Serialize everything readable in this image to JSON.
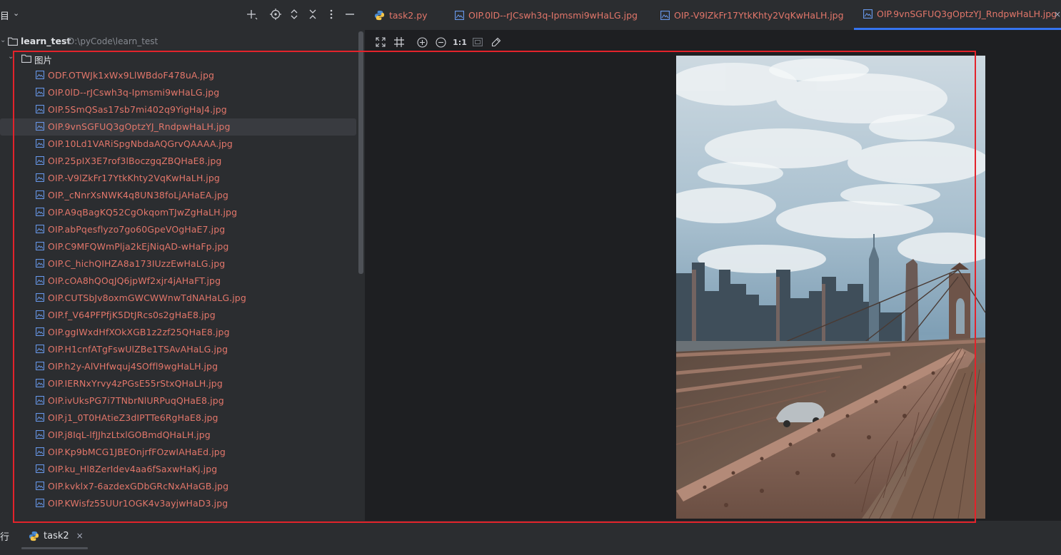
{
  "panel": {
    "title": "目",
    "root_name": "learn_test",
    "root_path": "D:\\pyCode\\learn_test",
    "folder_name": "图片",
    "files": [
      "ODF.OTWJk1xWx9LlWBdoF478uA.jpg",
      "OIP.0lD--rJCswh3q-Ipmsmi9wHaLG.jpg",
      "OIP.5SmQSas17sb7mi402q9YigHaJ4.jpg",
      "OIP.9vnSGFUQ3gOptzYJ_RndpwHaLH.jpg",
      "OIP.10Ld1VARiSpgNbdaAQGrvQAAAA.jpg",
      "OIP.25pIX3E7rof3lBoczgqZBQHaE8.jpg",
      "OIP.-V9lZkFr17YtkKhty2VqKwHaLH.jpg",
      "OIP._cNnrXsNWK4q8UN38foLjAHaEA.jpg",
      "OIP.A9qBagKQ52CgOkqomTJwZgHaLH.jpg",
      "OIP.abPqesflyzo7go60GpeVOgHaE7.jpg",
      "OIP.C9MFQWmPlja2kEjNiqAD-wHaFp.jpg",
      "OIP.C_hichQIHZA8a173IUzzEwHaLG.jpg",
      "OIP.cOA8hQOqJQ6jpWf2xjr4jAHaFT.jpg",
      "OIP.CUTSbJv8oxmGWCWWnwTdNAHaLG.jpg",
      "OIP.f_V64PFPfjK5DtJRcs0s2gHaE8.jpg",
      "OIP.ggIWxdHfXOkXGB1z2zf25QHaE8.jpg",
      "OIP.H1cnfATgFswUlZBe1TSAvAHaLG.jpg",
      "OIP.h2y-AlVHfwquj4SOffl9wgHaLH.jpg",
      "OIP.IERNxYrvy4zPGsE55rStxQHaLH.jpg",
      "OIP.ivUksPG7i7TNbrNlURPuqQHaE8.jpg",
      "OIP.j1_0T0HAtieZ3dIPTTe6RgHaE8.jpg",
      "OIP.j8IqL-lfJJhzLtxlGOBmdQHaLH.jpg",
      "OIP.Kp9bMCG1JBEOnjrfFOzwIAHaEd.jpg",
      "OIP.ku_Hl8ZerIdev4aa6fSaxwHaKj.jpg",
      "OIP.kvklx7-6azdexGDbGRcNxAHaGB.jpg",
      "OIP.KWisfz55UUr1OGK4v3ayjwHaD3.jpg"
    ],
    "selected_index": 3
  },
  "tabs": [
    {
      "label": "task2.py",
      "icon": "python-icon"
    },
    {
      "label": "OIP.0lD--rJCswh3q-Ipmsmi9wHaLG.jpg",
      "icon": "image-file-icon"
    },
    {
      "label": "OIP.-V9lZkFr17YtkKhty2VqKwHaLH.jpg",
      "icon": "image-file-icon"
    },
    {
      "label": "OIP.9vnSGFUQ3gOptzYJ_RndpwHaLH.jpg",
      "icon": "image-file-icon",
      "active": true
    }
  ],
  "toolbar": {
    "actual_size_label": "1:1"
  },
  "bottom": {
    "run_label": "行",
    "run_tab_label": "task2",
    "run_tab_close": "×"
  },
  "tab_close_glyph": "×",
  "colors": {
    "accent": "#3574f0",
    "file_text": "#e2766a",
    "annotation_frame": "#e3232b"
  }
}
